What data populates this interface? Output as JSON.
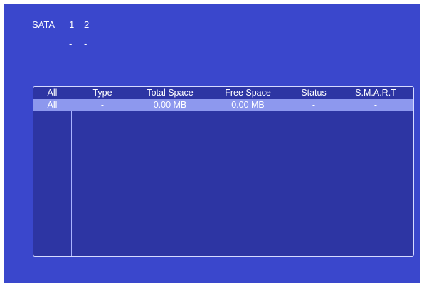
{
  "sata": {
    "label": "SATA",
    "ports": [
      "1",
      "2"
    ],
    "statuses": [
      "-",
      "-"
    ]
  },
  "table": {
    "columns": [
      "All",
      "Type",
      "Total Space",
      "Free Space",
      "Status",
      "S.M.A.R.T"
    ],
    "rows": [
      [
        "All",
        "-",
        "0.00 MB",
        "0.00 MB",
        "-",
        "-"
      ]
    ]
  },
  "colors": {
    "background": "#3a47cc",
    "table_background": "#2d35a3",
    "selected_row": "#8d98ee",
    "text": "#ffffff"
  }
}
